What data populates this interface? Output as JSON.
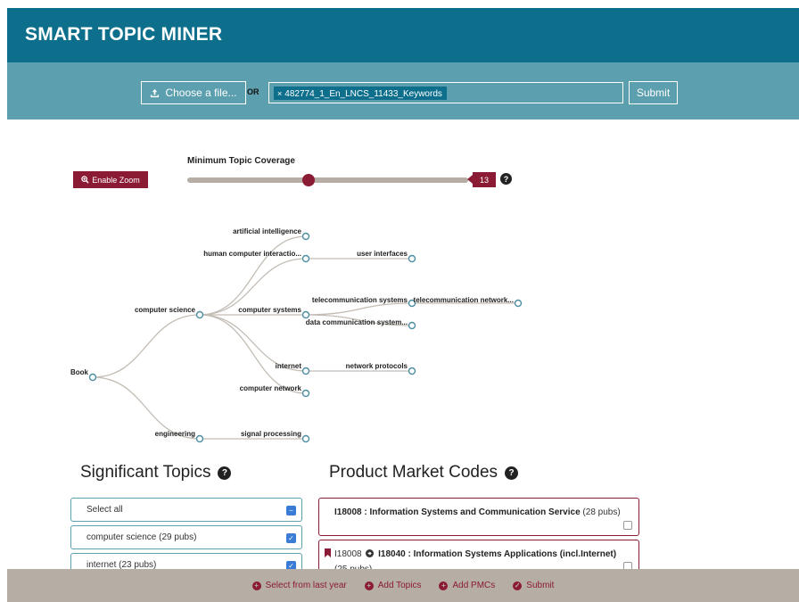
{
  "app": {
    "title": "SMART TOPIC MINER"
  },
  "toolbar": {
    "choose_file_label": "Choose a file...",
    "or_label": "OR",
    "selected_file": "482774_1_En_LNCS_11433_Keywords",
    "submit_label": "Submit"
  },
  "controls": {
    "zoom_label": "Enable Zoom",
    "slider_title": "Minimum Topic Coverage",
    "slider_value": "13",
    "slider_fraction": 0.43
  },
  "tree": {
    "nodes": [
      "Book",
      "computer science",
      "engineering",
      "artificial intelligence",
      "human computer interactio...",
      "computer systems",
      "internet",
      "computer network",
      "signal processing",
      "user interfaces",
      "telecommunication systems",
      "data communication system...",
      "network protocols",
      "telecommunication network..."
    ]
  },
  "topics": {
    "title": "Significant Topics",
    "items": [
      {
        "label": "Select all",
        "state": "indeterminate"
      },
      {
        "label": "computer science (29 pubs)",
        "state": "checked"
      },
      {
        "label": "internet (23 pubs)",
        "state": "checked"
      }
    ]
  },
  "pmc": {
    "title": "Product Market Codes",
    "cards": [
      {
        "code": "I18008 : Information Systems and Communication Service",
        "pubs": "(28 pubs)"
      },
      {
        "parent": "I18008",
        "code": "I18040 : Information Systems Applications (incl.Internet)",
        "pubs": "(25 pubs)"
      }
    ]
  },
  "footer": {
    "actions": [
      "Select from last year",
      "Add Topics",
      "Add PMCs",
      "Submit"
    ]
  },
  "colors": {
    "header": "#0d6f8c",
    "toolbar": "#5c9fae",
    "accent": "#8b1a34",
    "footer": "#b6aea4"
  }
}
